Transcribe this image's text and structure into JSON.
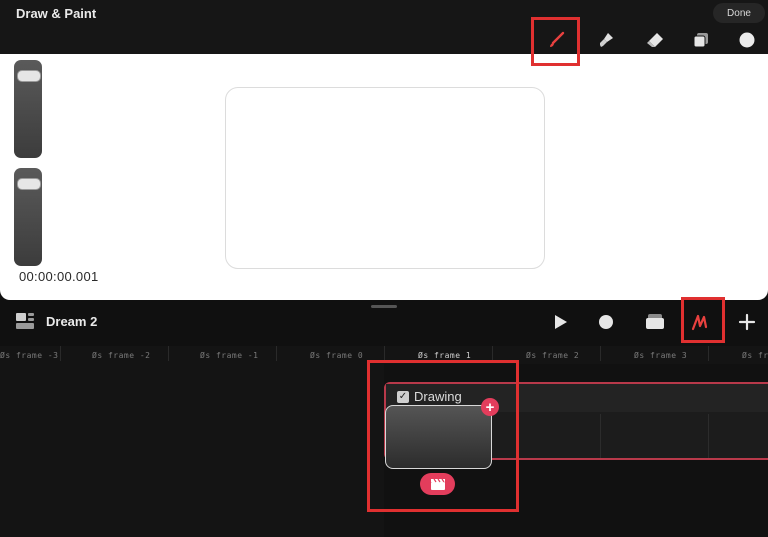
{
  "app": {
    "title": "Draw & Paint",
    "done_label": "Done"
  },
  "tools": [
    {
      "name": "brush",
      "icon": "brush-icon",
      "selected": true
    },
    {
      "name": "smudge",
      "icon": "smudge-icon"
    },
    {
      "name": "eraser",
      "icon": "eraser-icon"
    },
    {
      "name": "layers",
      "icon": "layers-icon"
    },
    {
      "name": "color",
      "icon": "color-circle-icon"
    }
  ],
  "canvas": {
    "timecode": "00:00:00.001"
  },
  "project": {
    "title": "Dream 2"
  },
  "controls": [
    "play-icon",
    "record-dot-icon",
    "onion-skin-icon",
    "draw-mode-icon",
    "add-icon"
  ],
  "ruler": {
    "labels": [
      "Øs frame -3",
      "Øs frame -2",
      "Øs frame -1",
      "Øs frame 0",
      "Øs frame 1",
      "Øs frame 2",
      "Øs frame 3",
      "Øs fram"
    ]
  },
  "track": {
    "name": "Drawing",
    "checked": true
  },
  "colors": {
    "accent": "#e33d5c",
    "annotation": "#e03030",
    "selected_tool": "#e8413f"
  }
}
